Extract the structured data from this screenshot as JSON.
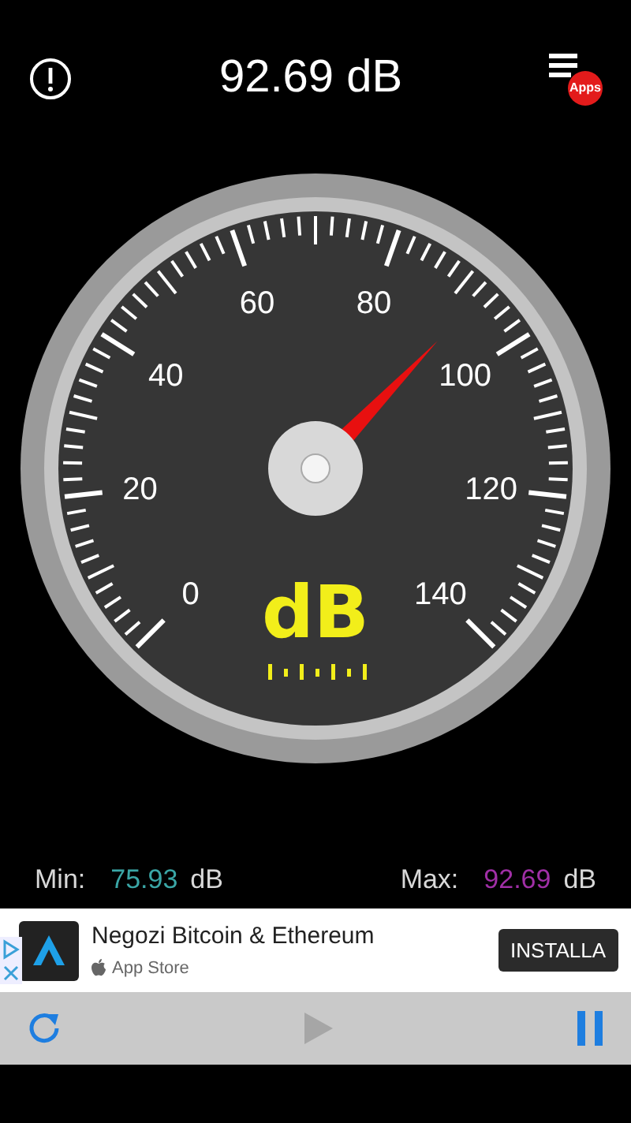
{
  "header": {
    "title": "92.69 dB",
    "menu_badge": "Apps"
  },
  "gauge": {
    "scale_labels": [
      "0",
      "20",
      "40",
      "60",
      "80",
      "100",
      "120",
      "140"
    ],
    "unit": "dB"
  },
  "stats": [
    {
      "label": "Min:",
      "value": "75.93",
      "unit": "dB",
      "color": "#3aa6a6"
    },
    {
      "label": "Max:",
      "value": "92.69",
      "unit": "dB",
      "color": "#a02fa6"
    }
  ],
  "ad": {
    "title": "Negozi Bitcoin & Ethereum",
    "store": "App Store",
    "button": "INSTALLA"
  },
  "toolbar": {
    "play_disabled": true
  }
}
